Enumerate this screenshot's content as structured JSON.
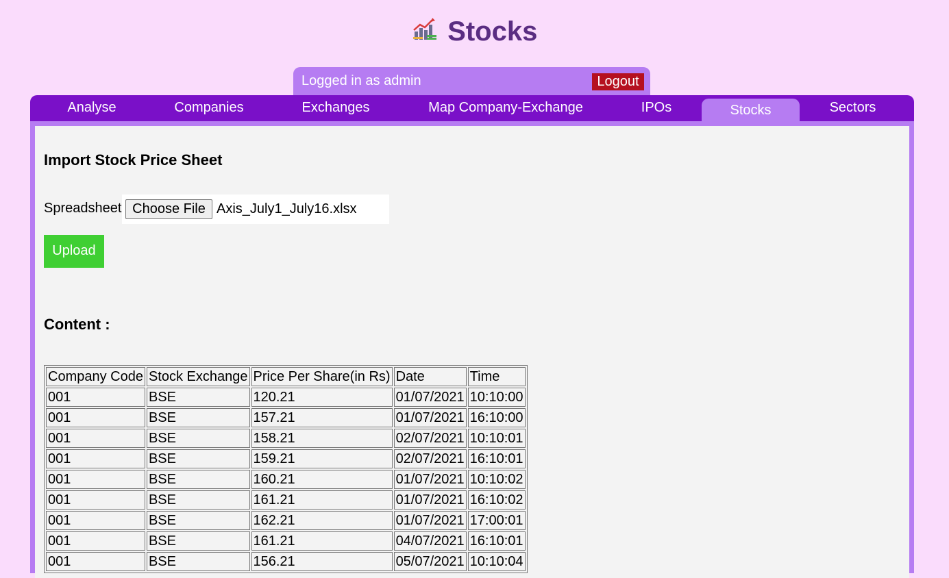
{
  "header": {
    "title": "Stocks",
    "logo_icon": "stocks-chart-icon"
  },
  "user": {
    "status": "Logged in as admin",
    "logout_label": "Logout"
  },
  "nav": {
    "items": [
      {
        "label": "Analyse"
      },
      {
        "label": "Companies"
      },
      {
        "label": "Exchanges"
      },
      {
        "label": "Map Company-Exchange"
      },
      {
        "label": "IPOs"
      },
      {
        "label": "Stocks",
        "active": true
      },
      {
        "label": "Sectors"
      }
    ]
  },
  "import": {
    "title": "Import Stock Price Sheet",
    "spreadsheet_label": "Spreadsheet",
    "choose_file_label": "Choose File",
    "file_name": "Axis_July1_July16.xlsx",
    "upload_label": "Upload"
  },
  "content": {
    "title": "Content :",
    "columns": [
      "Company Code",
      "Stock Exchange",
      "Price Per Share(in Rs)",
      "Date",
      "Time"
    ],
    "rows": [
      [
        "001",
        "BSE",
        "120.21",
        "01/07/2021",
        "10:10:00"
      ],
      [
        "001",
        "BSE",
        "157.21",
        "01/07/2021",
        "16:10:00"
      ],
      [
        "001",
        "BSE",
        "158.21",
        "02/07/2021",
        "10:10:01"
      ],
      [
        "001",
        "BSE",
        "159.21",
        "02/07/2021",
        "16:10:01"
      ],
      [
        "001",
        "BSE",
        "160.21",
        "01/07/2021",
        "10:10:02"
      ],
      [
        "001",
        "BSE",
        "161.21",
        "01/07/2021",
        "16:10:02"
      ],
      [
        "001",
        "BSE",
        "162.21",
        "01/07/2021",
        "17:00:01"
      ],
      [
        "001",
        "BSE",
        "161.21",
        "04/07/2021",
        "16:10:01"
      ],
      [
        "001",
        "BSE",
        "156.21",
        "05/07/2021",
        "10:10:04"
      ]
    ]
  },
  "colors": {
    "background": "#fadcfc",
    "nav": "#7a10c8",
    "nav_active": "#b67cf2",
    "title": "#5a2d82",
    "logout": "#b5101f",
    "upload": "#3fcf33"
  }
}
